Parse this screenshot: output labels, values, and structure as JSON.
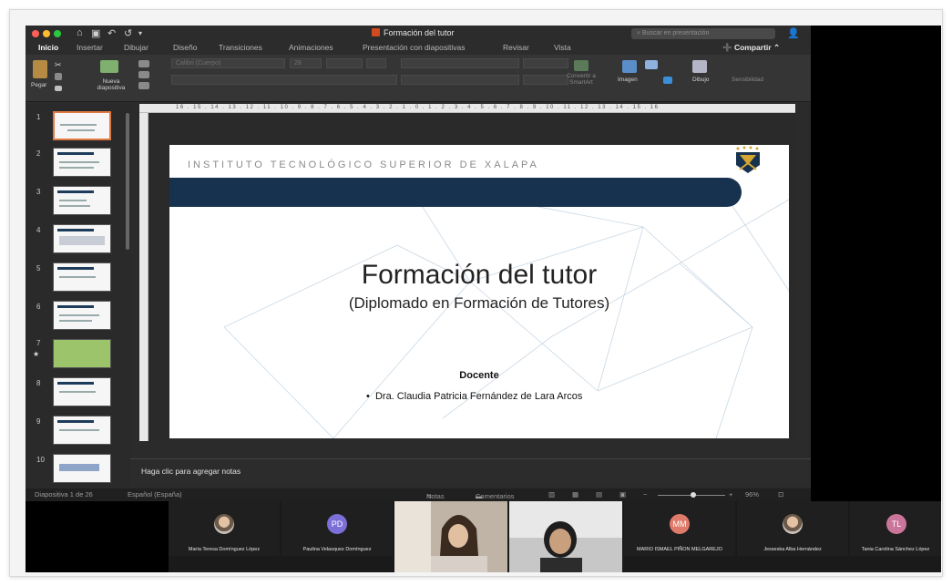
{
  "window": {
    "doc_title": "Formación del tutor",
    "search_placeholder": "Buscar en presentación"
  },
  "tabs": [
    "Inicio",
    "Insertar",
    "Dibujar",
    "Diseño",
    "Transiciones",
    "Animaciones",
    "Presentación con diapositivas",
    "Revisar",
    "Vista"
  ],
  "share_label": "Compartir",
  "ribbon": {
    "paste": "Pegar",
    "new_slide": "Nueva diapositiva",
    "font": "Calibri (Cuerpo)",
    "size": "28",
    "smartart": "Convertir a SmartArt",
    "image": "Imagen",
    "drawing": "Dibujo",
    "sensitivity": "Sensibilidad"
  },
  "ruler_text": "16 . 15 . 14 . 13 . 12 . 11 . 10 . 9 . 8 . 7 . 6 . 5 . 4 . 3 . 2 . 1 . 0 . 1 . 2 . 3 . 4 . 5 . 6 . 7 . 8 . 9 . 10 . 11 . 12 . 13 . 14 . 15 . 16",
  "thumbnails": [
    "1",
    "2",
    "3",
    "4",
    "5",
    "6",
    "7",
    "8",
    "9",
    "10"
  ],
  "slide": {
    "institution": "INSTITUTO TECNOLÓGICO SUPERIOR DE XALAPA",
    "title": "Formación del tutor",
    "subtitle": "(Diplomado en Formación de Tutores)",
    "docente_label": "Docente",
    "docente_name": "Dra. Claudia Patricia Fernández de Lara Arcos",
    "bar_color": "#17324f"
  },
  "notes_placeholder": "Haga clic para agregar notas",
  "status": {
    "slide_counter": "Diapositiva 1 de 26",
    "language": "Español (España)",
    "notes": "Notas",
    "comments": "Comentarios",
    "zoom": "96%"
  },
  "participants": [
    {
      "name": "María Teresa Domínguez López",
      "kind": "photo"
    },
    {
      "name": "Paulina Velasquez Domínguez",
      "initials": "PD",
      "color": "#7c6fd8"
    },
    {
      "name": "",
      "kind": "video"
    },
    {
      "name": "",
      "kind": "video"
    },
    {
      "name": "MARIO ISMAEL PIÑON MELGAREJO",
      "initials": "MM",
      "color": "#e07a6a"
    },
    {
      "name": "Jesseska Alba Hernández",
      "kind": "photo"
    },
    {
      "name": "Tania Carolina Sánchez López",
      "initials": "TL",
      "color": "#c9769a"
    }
  ]
}
